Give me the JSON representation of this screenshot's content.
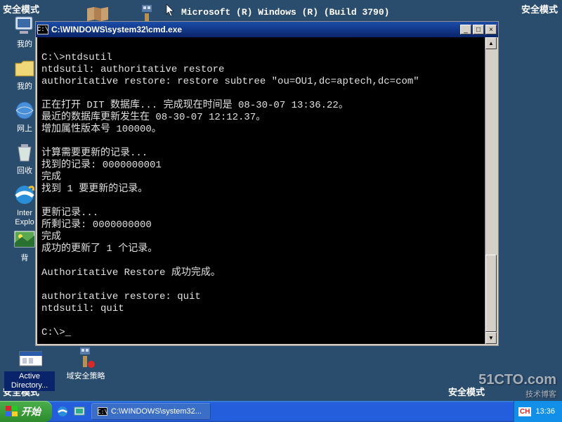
{
  "safe_mode_label": "安全模式",
  "os_banner": "Microsoft (R) Windows (R) (Build 3790)",
  "desktop": {
    "icons": [
      {
        "name": "my-computer",
        "label": "我的"
      },
      {
        "name": "my-documents",
        "label": "我的"
      },
      {
        "name": "network",
        "label": "网上"
      },
      {
        "name": "recycle-bin",
        "label": "回收"
      },
      {
        "name": "internet-explorer",
        "label": "Inter\nExplo"
      },
      {
        "name": "wallpaper",
        "label": "背"
      },
      {
        "name": "active-directory",
        "label": "Active\nDirectory..."
      },
      {
        "name": "domain-policy",
        "label": "域安全策略"
      }
    ],
    "top_icons": [
      {
        "name": "book-icon"
      },
      {
        "name": "tools-icon"
      }
    ]
  },
  "cmd": {
    "title": "C:\\WINDOWS\\system32\\cmd.exe",
    "lines": [
      "",
      "C:\\>ntdsutil",
      "ntdsutil: authoritative restore",
      "authoritative restore: restore subtree \"ou=OU1,dc=aptech,dc=com\"",
      "",
      "正在打开 DIT 数据库... 完成现在时间是 08-30-07 13:36.22。",
      "最近的数据库更新发生在 08-30-07 12:12.37。",
      "增加属性版本号 100000。",
      "",
      "计算需要更新的记录...",
      "找到的记录: 0000000001",
      "完成",
      "找到 1 要更新的记录。",
      "",
      "更新记录...",
      "所剩记录: 0000000000",
      "完成",
      "成功的更新了 1 个记录。",
      "",
      "Authoritative Restore 成功完成。",
      "",
      "authoritative restore: quit",
      "ntdsutil: quit",
      "",
      "C:\\>_"
    ],
    "buttons": {
      "min": "_",
      "max": "□",
      "close": "×"
    }
  },
  "taskbar": {
    "start": "开始",
    "task_item": "C:\\WINDOWS\\system32..."
  },
  "tray": {
    "time": "13:36",
    "lang": "CH"
  },
  "watermark": {
    "main": "51CTO.com",
    "sub": "技术博客"
  }
}
